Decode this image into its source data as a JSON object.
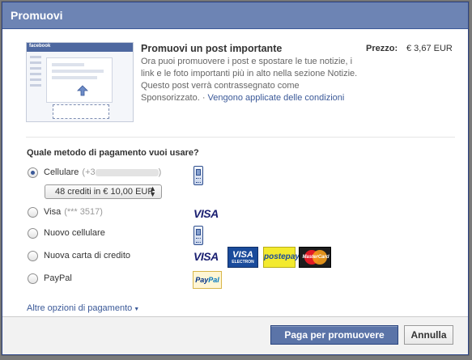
{
  "dialog": {
    "title": "Promuovi"
  },
  "promo": {
    "thumb_brand": "facebook",
    "title": "Promuovi un post importante",
    "description": "Ora puoi promuovere i post e spostare le tue notizie, i link e le foto importanti più in alto nella sezione Notizie. Questo post verrà contrassegnato come Sponsorizzato. ·",
    "conditions_link": "Vengono applicate delle condizioni",
    "price_label": "Prezzo:",
    "price_value": "€ 3,67 EUR"
  },
  "payment": {
    "question": "Quale metodo di pagamento vuoi usare?",
    "options": [
      {
        "label": "Cellulare",
        "sub": "(+3",
        "sub_end": ")",
        "selected": true,
        "icon": "mobile-phone-icon"
      },
      {
        "label": "Visa",
        "sub": "(*** 3517)",
        "selected": false,
        "icon": "visa-logo-icon"
      },
      {
        "label": "Nuovo cellulare",
        "sub": "",
        "selected": false,
        "icon": "mobile-phone-icon"
      },
      {
        "label": "Nuova carta di credito",
        "sub": "",
        "selected": false,
        "icon": "credit-cards-icon"
      },
      {
        "label": "PayPal",
        "sub": "",
        "selected": false,
        "icon": "paypal-logo-icon"
      }
    ],
    "credits_select": "48 crediti in € 10,00 EUR",
    "card_logos": {
      "visa": "VISA",
      "visa_electron": "VISA",
      "visa_electron_sub": "ELECTRON",
      "postepay": "postepay",
      "mastercard": "MasterCard",
      "paypal_a": "Pay",
      "paypal_b": "Pal"
    },
    "more_options": "Altre opzioni di pagamento"
  },
  "footer": {
    "pay_button": "Paga per promuovere",
    "cancel_button": "Annulla"
  },
  "colors": {
    "titlebar": "#6d84b4",
    "link": "#3b5998",
    "primary_button": "#5b74a8"
  }
}
